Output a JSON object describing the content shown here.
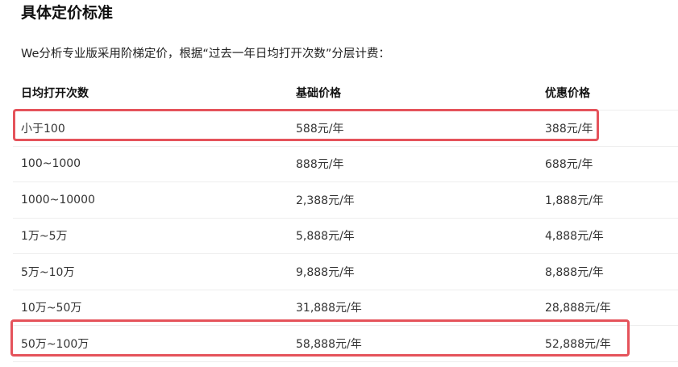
{
  "title": "具体定价标准",
  "intro": "We分析专业版采用阶梯定价，根据“过去一年日均打开次数”分层计费：",
  "table": {
    "headers": [
      "日均打开次数",
      "基础价格",
      "优惠价格"
    ],
    "rows": [
      [
        "小于100",
        "588元/年",
        "388元/年"
      ],
      [
        "100~1000",
        "888元/年",
        "688元/年"
      ],
      [
        "1000~10000",
        "2,388元/年",
        "1,888元/年"
      ],
      [
        "1万~5万",
        "5,888元/年",
        "4,888元/年"
      ],
      [
        "5万~10万",
        "9,888元/年",
        "8,888元/年"
      ],
      [
        "10万~50万",
        "31,888元/年",
        "28,888元/年"
      ],
      [
        "50万~100万",
        "58,888元/年",
        "52,888元/年"
      ]
    ]
  },
  "colors": {
    "highlight": "#e5535b",
    "divider": "#eeeeee"
  }
}
